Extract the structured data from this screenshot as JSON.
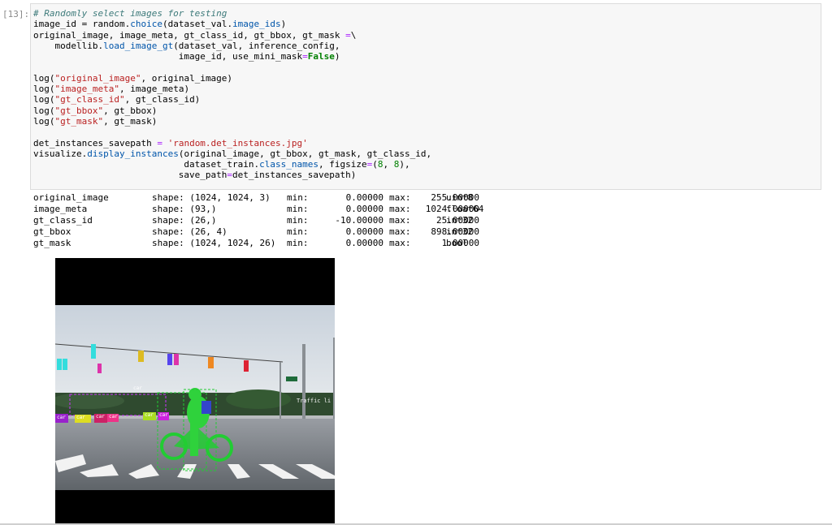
{
  "cell": {
    "prompt": "[13]:",
    "code": {
      "l1_comment": "# Randomly select images for testing",
      "l2_a": "image_id = random.",
      "l2_fn": "choice",
      "l2_b": "(dataset_val.",
      "l2_attr": "image_ids",
      "l2_c": ")",
      "l3_a": "original_image, image_meta, gt_class_id, gt_bbox, gt_mask ",
      "l3_op": "=",
      "l3_b": "\\",
      "l4_a": "    modellib.",
      "l4_fn": "load_image_gt",
      "l4_b": "(dataset_val, inference_config,",
      "l5_a": "                           image_id, use_mini_mask",
      "l5_op": "=",
      "l5_kw": "False",
      "l5_b": ")",
      "l7_a": "log(",
      "l7_str": "\"original_image\"",
      "l7_b": ", original_image)",
      "l8_a": "log(",
      "l8_str": "\"image_meta\"",
      "l8_b": ", image_meta)",
      "l9_a": "log(",
      "l9_str": "\"gt_class_id\"",
      "l9_b": ", gt_class_id)",
      "l10_a": "log(",
      "l10_str": "\"gt_bbox\"",
      "l10_b": ", gt_bbox)",
      "l11_a": "log(",
      "l11_str": "\"gt_mask\"",
      "l11_b": ", gt_mask)",
      "l13_a": "det_instances_savepath ",
      "l13_op": "=",
      "l13_str": " 'random.det_instances.jpg'",
      "l14_a": "visualize.",
      "l14_fn": "display_instances",
      "l14_b": "(original_image, gt_bbox, gt_mask, gt_class_id,",
      "l15_a": "                            dataset_train.",
      "l15_attr": "class_names",
      "l15_b": ", figsize",
      "l15_op": "=",
      "l15_c": "(",
      "l15_n1": "8",
      "l15_d": ", ",
      "l15_n2": "8",
      "l15_e": "),",
      "l16_a": "                           save_path",
      "l16_op": "=",
      "l16_b": "det_instances_savepath)"
    }
  },
  "output": {
    "rows": [
      {
        "name": "original_image",
        "shape": "shape: (1024, 1024, 3)",
        "min_label": "min:",
        "min": "0.00000",
        "max_label": "max:",
        "max": "255.00000",
        "dtype": "uint8"
      },
      {
        "name": "image_meta",
        "shape": "shape: (93,)",
        "min_label": "min:",
        "min": "0.00000",
        "max_label": "max:",
        "max": "1024.00000",
        "dtype": "float64"
      },
      {
        "name": "gt_class_id",
        "shape": "shape: (26,)",
        "min_label": "min:",
        "min": "-10.00000",
        "max_label": "max:",
        "max": "25.00000",
        "dtype": "int32"
      },
      {
        "name": "gt_bbox",
        "shape": "shape: (26, 4)",
        "min_label": "min:",
        "min": "0.00000",
        "max_label": "max:",
        "max": "898.00000",
        "dtype": "int32"
      },
      {
        "name": "gt_mask",
        "shape": "shape: (1024, 1024, 26)",
        "min_label": "min:",
        "min": "0.00000",
        "max_label": "max:",
        "max": "1.00000",
        "dtype": "bool"
      }
    ]
  },
  "figure": {
    "box_labels": [
      "car",
      "car",
      "car",
      "car",
      "car",
      "car",
      "car"
    ],
    "sign_text": "Traffic li"
  },
  "colors": {
    "cell_bg": "#f7f7f7",
    "comment": "#3d7a7a",
    "string": "#ba2121",
    "function": "#0055aa",
    "keyword": "#008000",
    "operator": "#aa22ff",
    "cyclist_mask": "#22cc33",
    "magenta_box": "#cc33ff"
  }
}
